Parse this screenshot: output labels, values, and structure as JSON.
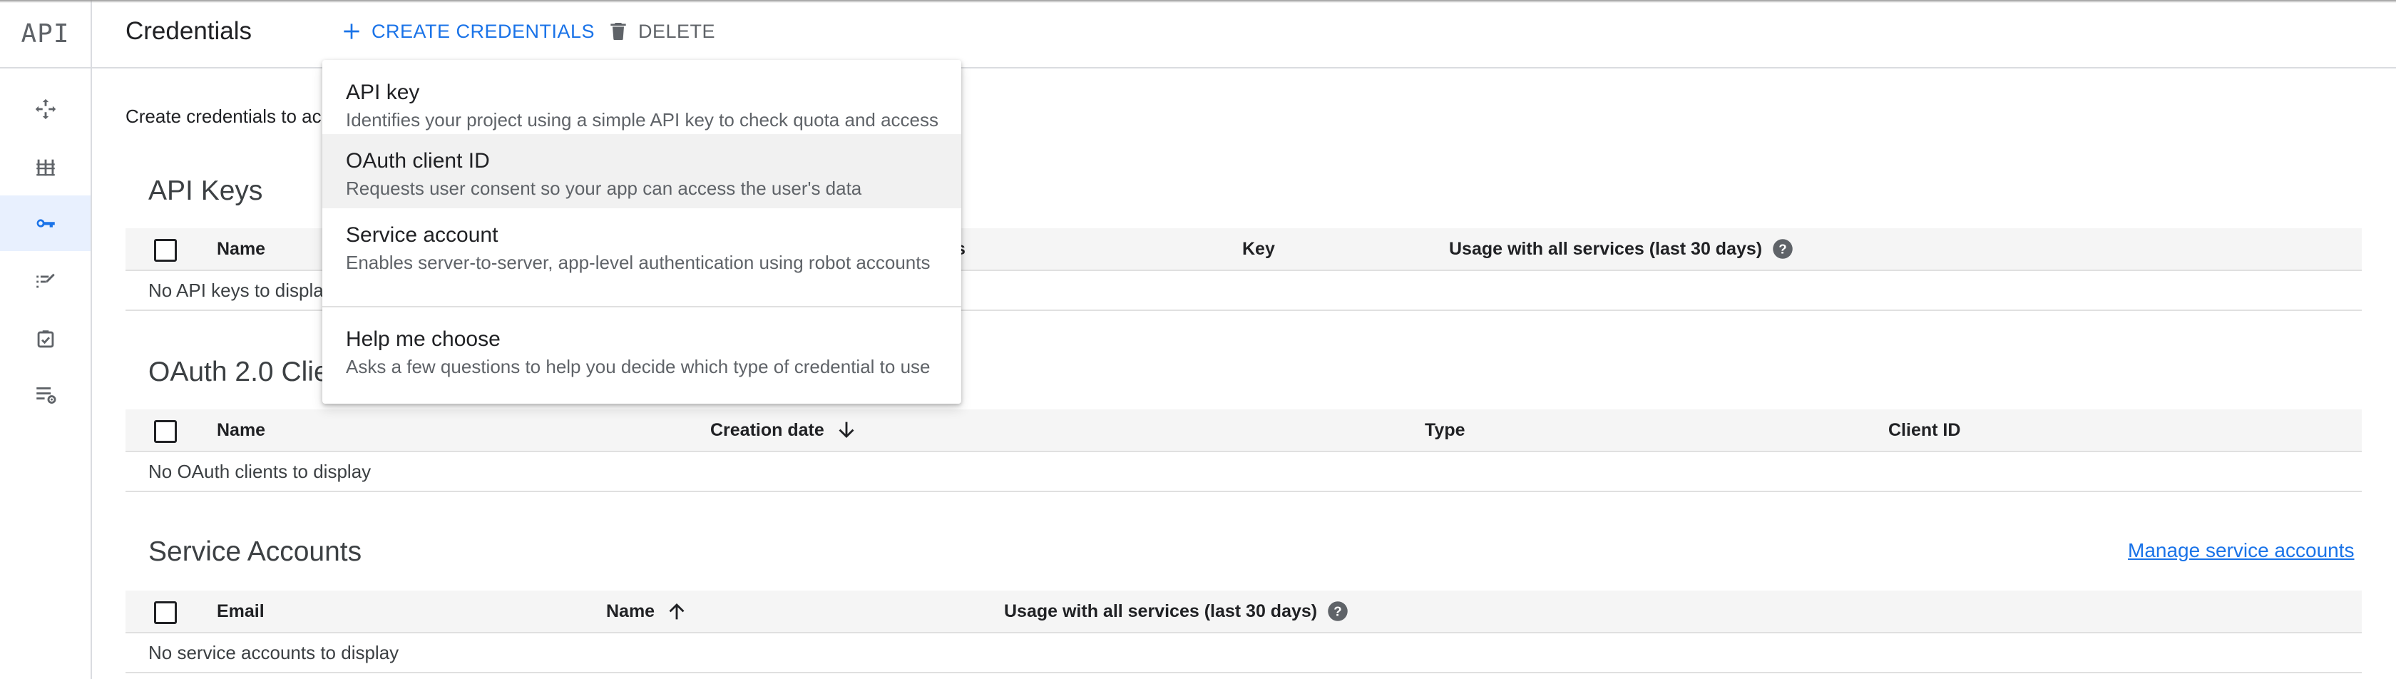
{
  "app": {
    "logo_text": "API"
  },
  "sidebar": {
    "items": [
      {
        "icon": "move-icon",
        "active": false
      },
      {
        "icon": "library-icon",
        "active": false
      },
      {
        "icon": "key-icon",
        "active": true
      },
      {
        "icon": "consent-icon",
        "active": false
      },
      {
        "icon": "checkbox-page-icon",
        "active": false
      },
      {
        "icon": "settings-list-icon",
        "active": false
      }
    ]
  },
  "header": {
    "title": "Credentials",
    "create_label": "CREATE CREDENTIALS",
    "delete_label": "DELETE"
  },
  "main": {
    "intro": "Create credentials to ac",
    "api_keys": {
      "title": "API Keys",
      "columns": [
        "Name",
        "s",
        "Key",
        "Usage with all services (last 30 days)"
      ],
      "empty": "No API keys to displa"
    },
    "oauth": {
      "title": "OAuth 2.0 Clie",
      "columns": [
        "Name",
        "Creation date",
        "Type",
        "Client ID"
      ],
      "empty": "No OAuth clients to display"
    },
    "service_accounts": {
      "title": "Service Accounts",
      "manage_link": "Manage service accounts",
      "columns": [
        "Email",
        "Name",
        "Usage with all services (last 30 days)"
      ],
      "empty": "No service accounts to display"
    }
  },
  "menu": {
    "items": [
      {
        "title": "API key",
        "desc": "Identifies your project using a simple API key to check quota and access"
      },
      {
        "title": "OAuth client ID",
        "desc": "Requests user consent so your app can access the user's data"
      },
      {
        "title": "Service account",
        "desc": "Enables server-to-server, app-level authentication using robot accounts"
      },
      {
        "title": "Help me choose",
        "desc": "Asks a few questions to help you decide which type of credential to use"
      }
    ]
  },
  "colors": {
    "accent": "#1a73e8",
    "active_nav_bg": "#e8f0fe",
    "header_bg": "#f5f5f5"
  }
}
